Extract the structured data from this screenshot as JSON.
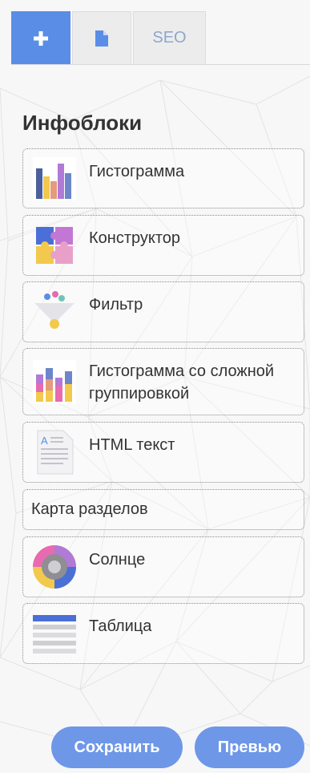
{
  "tabs": [
    {
      "label": "",
      "icon": "plus-icon",
      "active": true
    },
    {
      "label": "",
      "icon": "document-icon",
      "active": false
    },
    {
      "label": "SEO",
      "icon": null,
      "active": false
    }
  ],
  "heading": "Инфоблоки",
  "blocks": [
    {
      "label": "Гистограмма",
      "icon": "histogram-icon"
    },
    {
      "label": "Конструктор",
      "icon": "puzzle-icon"
    },
    {
      "label": "Фильтр",
      "icon": "filter-funnel-icon"
    },
    {
      "label": "Гистограмма со сложной группировкой",
      "icon": "grouped-histogram-icon"
    },
    {
      "label": "HTML текст",
      "icon": "html-text-icon"
    },
    {
      "label": "Карта разделов",
      "icon": null
    },
    {
      "label": "Солнце",
      "icon": "sunburst-icon"
    },
    {
      "label": "Таблица",
      "icon": "table-icon"
    }
  ],
  "buttons": {
    "save": "Сохранить",
    "preview": "Превью"
  },
  "colors": {
    "accent": "#5a8ee6",
    "button": "#6e97e8"
  }
}
